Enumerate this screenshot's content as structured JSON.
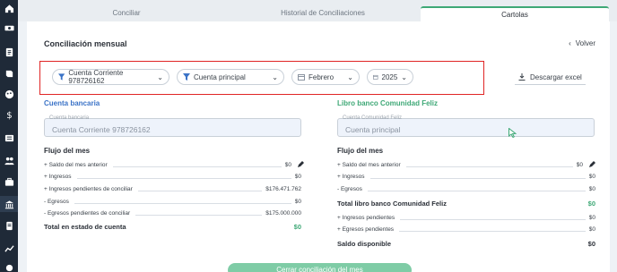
{
  "tabs": [
    "Conciliar",
    "Historial de Conciliaciones",
    "Cartolas"
  ],
  "page_title": "Conciliación mensual",
  "back_label": "Volver",
  "filters": {
    "account": "Cuenta Corriente 978726162",
    "book": "Cuenta principal",
    "month": "Febrero",
    "year": "2025"
  },
  "excel_label": "Descargar excel",
  "bank": {
    "section_title": "Cuenta bancaria",
    "field_label": "Cuenta bancaria",
    "field_value": "Cuenta Corriente 978726162",
    "flow_title": "Flujo del mes",
    "rows": [
      {
        "label": "+ Saldo del mes anterior",
        "value": "$0"
      },
      {
        "label": "+ Ingresos",
        "value": "$0"
      },
      {
        "label": "+ Ingresos pendientes de conciliar",
        "value": "$176.471.762"
      },
      {
        "label": "- Egresos",
        "value": "$0"
      },
      {
        "label": "- Egresos pendientes de conciliar",
        "value": "$175.000.000"
      }
    ],
    "total_label": "Total en estado de cuenta",
    "total_value": "$0"
  },
  "book": {
    "section_title": "Libro banco Comunidad Feliz",
    "field_label": "Cuenta Comunidad Feliz",
    "field_value": "Cuenta principal",
    "flow_title": "Flujo del mes",
    "rows": [
      {
        "label": "+ Saldo del mes anterior",
        "value": "$0"
      },
      {
        "label": "+ Ingresos",
        "value": "$0"
      },
      {
        "label": "- Egresos",
        "value": "$0"
      }
    ],
    "total_label": "Total libro banco Comunidad Feliz",
    "total_value": "$0",
    "rows2": [
      {
        "label": "+ Ingresos pendientes",
        "value": "$0"
      },
      {
        "label": "+ Egresos pendientes",
        "value": "$0"
      }
    ],
    "balance_label": "Saldo disponible",
    "balance_value": "$0"
  },
  "cta_label": "Cerrar conciliación del mes",
  "colors": {
    "accent": "#3ea876",
    "link_blue": "#3b73c7",
    "highlight": "#e02424",
    "sidebar": "#1f2a38"
  }
}
